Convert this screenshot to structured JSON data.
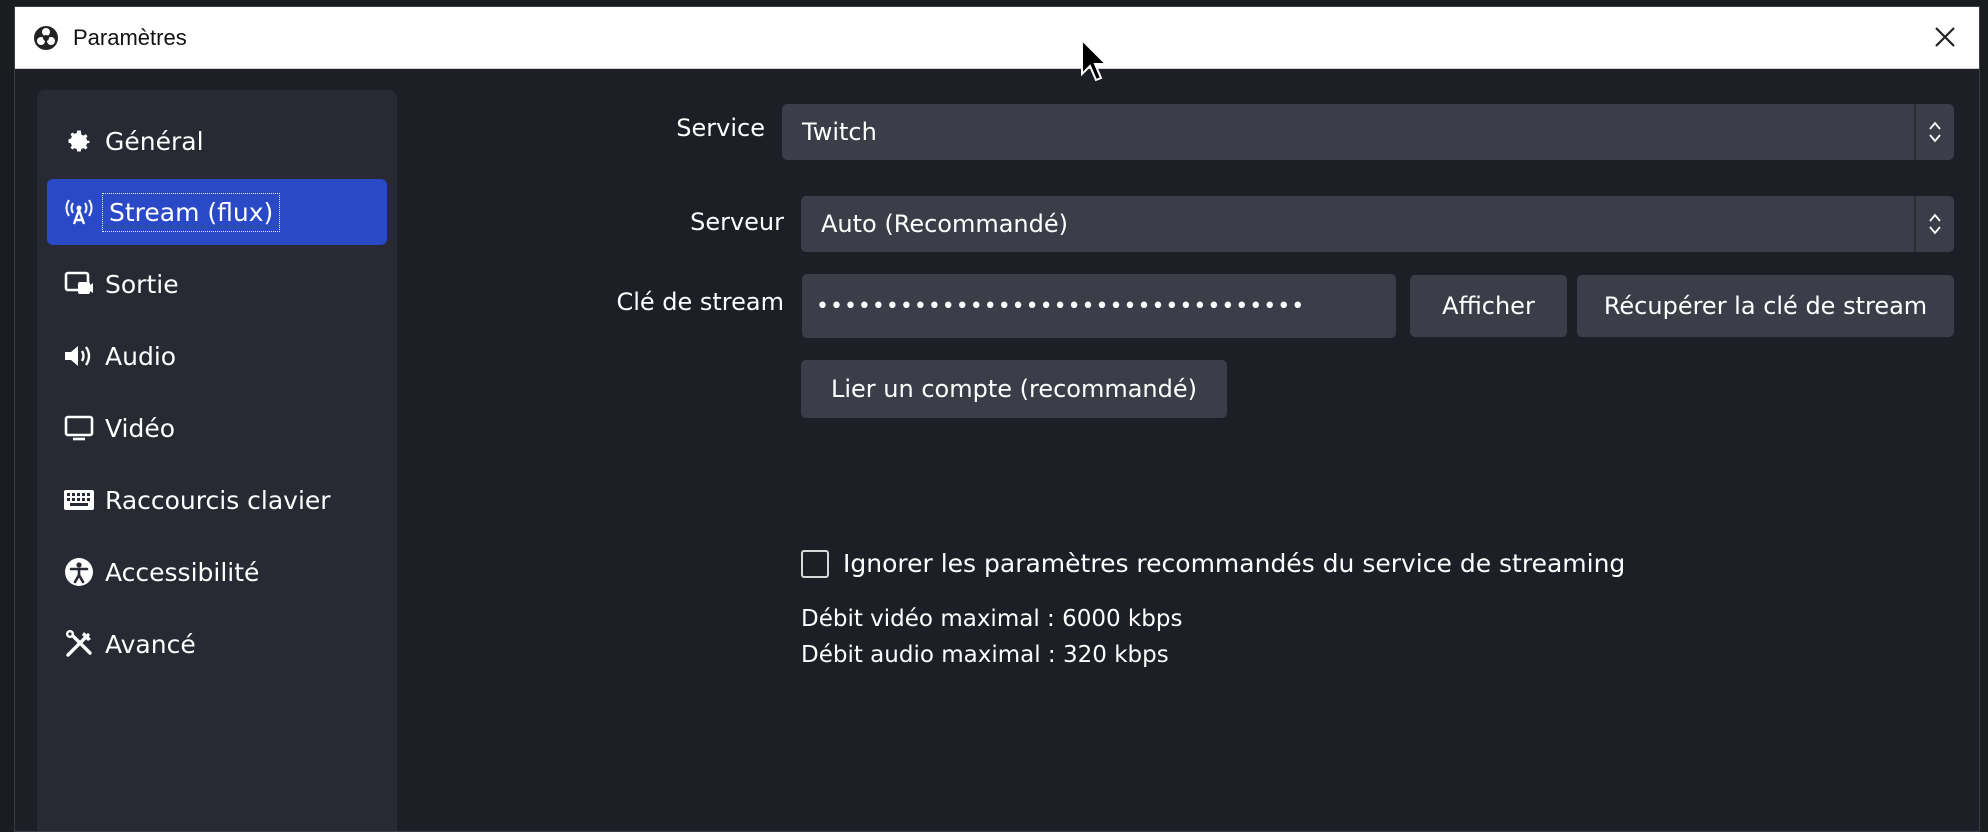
{
  "window": {
    "title": "Paramètres"
  },
  "sidebar": {
    "items": [
      {
        "label": "Général",
        "icon": "gear-icon"
      },
      {
        "label": "Stream (flux)",
        "icon": "antenna-icon"
      },
      {
        "label": "Sortie",
        "icon": "output-icon"
      },
      {
        "label": "Audio",
        "icon": "speaker-icon"
      },
      {
        "label": "Vidéo",
        "icon": "monitor-icon"
      },
      {
        "label": "Raccourcis clavier",
        "icon": "keyboard-icon"
      },
      {
        "label": "Accessibilité",
        "icon": "accessibility-icon"
      },
      {
        "label": "Avancé",
        "icon": "tools-icon"
      }
    ],
    "active_index": 1
  },
  "stream": {
    "service_label": "Service",
    "service_value": "Twitch",
    "server_label": "Serveur",
    "server_value": "Auto (Recommandé)",
    "key_label": "Clé de stream",
    "key_value": "•••••••••••••••••••••••••••••••••••",
    "show_button": "Afficher",
    "get_key_button": "Récupérer la clé de stream",
    "link_account_button": "Lier un compte (recommandé)",
    "ignore_checkbox_label": "Ignorer les paramètres recommandés du service de streaming",
    "ignore_checked": false,
    "max_video_bitrate": "Débit vidéo maximal : 6000 kbps",
    "max_audio_bitrate": "Débit audio maximal : 320 kbps"
  },
  "colors": {
    "accent": "#2a49c6",
    "panel": "#272a33",
    "field": "#3b3e48",
    "background": "#1d1f26"
  }
}
